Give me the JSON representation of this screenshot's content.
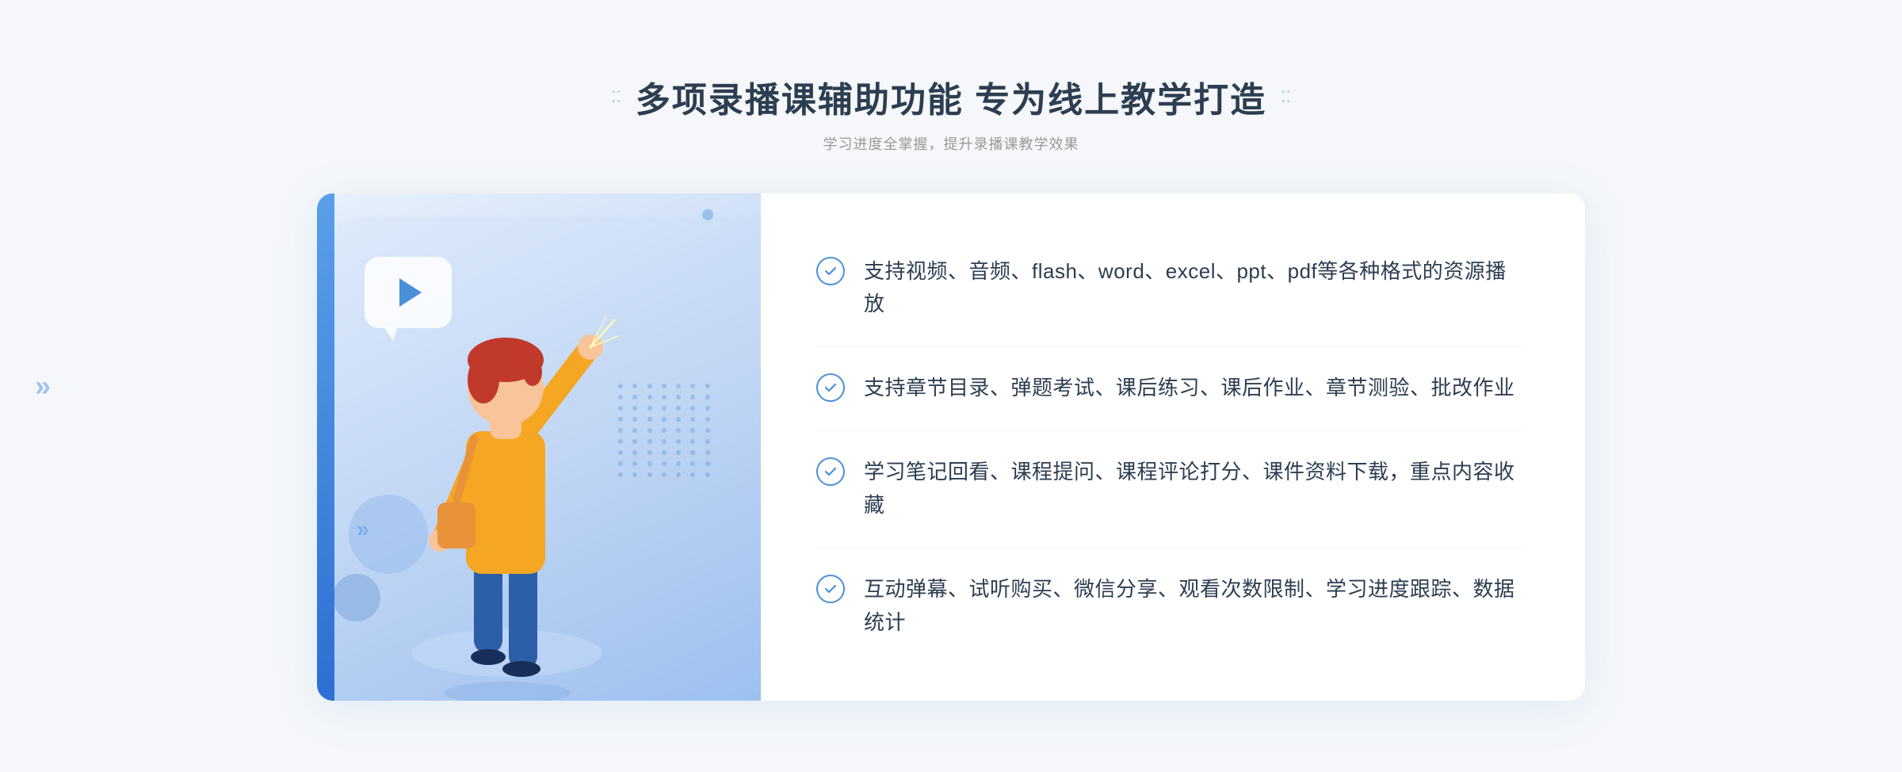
{
  "header": {
    "title": "多项录播课辅助功能 专为线上教学打造",
    "subtitle": "学习进度全掌握，提升录播课教学效果",
    "dot_left": "⁞⁞",
    "dot_right": "⁞⁞"
  },
  "features": [
    {
      "id": 1,
      "text": "支持视频、音频、flash、word、excel、ppt、pdf等各种格式的资源播放"
    },
    {
      "id": 2,
      "text": "支持章节目录、弹题考试、课后练习、课后作业、章节测验、批改作业"
    },
    {
      "id": 3,
      "text": "学习笔记回看、课程提问、课程评论打分、课件资料下载，重点内容收藏"
    },
    {
      "id": 4,
      "text": "互动弹幕、试听购买、微信分享、观看次数限制、学习进度跟踪、数据统计"
    }
  ],
  "colors": {
    "accent": "#4a90d9",
    "title_dark": "#2c3e50",
    "subtitle_gray": "#999999",
    "feature_text": "#2c3e50",
    "bg": "#f5f7fa",
    "panel_gradient_start": "#e8f1fc",
    "panel_gradient_end": "#85aee8"
  },
  "illustration": {
    "play_icon": "▶",
    "arrow_left": "«"
  }
}
